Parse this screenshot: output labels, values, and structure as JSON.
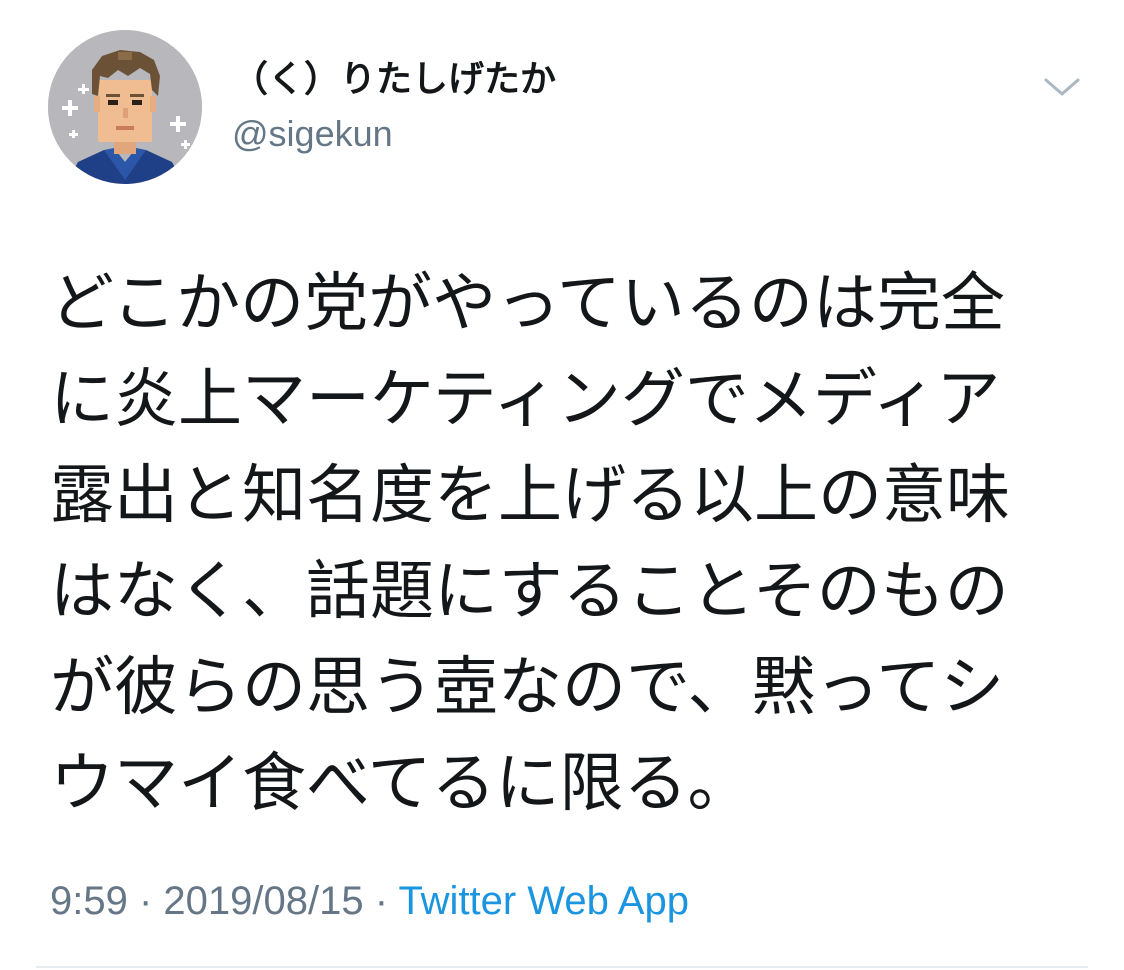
{
  "author": {
    "display_name": "（く）りたしげたか",
    "handle": "@sigekun",
    "avatar": "pixel-art-avatar"
  },
  "menu": {
    "icon": "chevron-down-icon"
  },
  "tweet": {
    "lines": [
      "どこかの党がやっているのは完全",
      "に炎上マーケティングでメディア",
      "露出と知名度を上げる以上の意味",
      "はなく、話題にすることそのもの",
      "が彼らの思う壺なので、黙ってシ",
      "ウマイ食べてるに限る。"
    ]
  },
  "meta": {
    "time": "9:59",
    "separator1": " · ",
    "date": "2019/08/15",
    "separator2": " · ",
    "source": "Twitter Web App"
  },
  "colors": {
    "text": "#14171a",
    "secondary": "#657786",
    "link": "#1b95e0",
    "divider": "#e6ecf0"
  }
}
